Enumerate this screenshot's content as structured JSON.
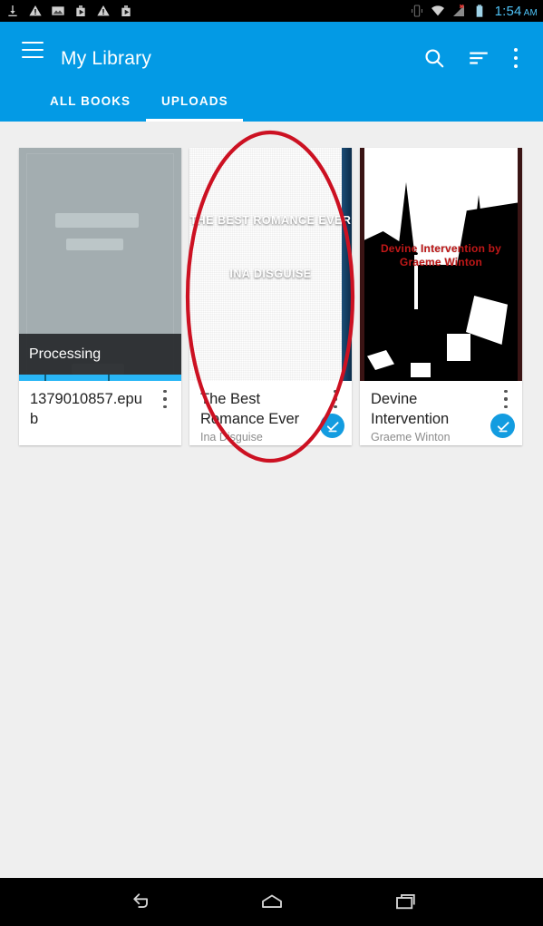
{
  "statusbar": {
    "left_icons": [
      "download-icon",
      "warning-icon",
      "image-icon",
      "play-store-icon",
      "warning-icon",
      "play-store-icon"
    ],
    "right_icons": [
      "vibrate-icon",
      "wifi-icon",
      "cell-signal-no-service-icon",
      "battery-icon"
    ],
    "time": "1:54",
    "ampm": "AM",
    "time_color": "#4fc3f7"
  },
  "appbar": {
    "title": "My Library",
    "menu_icon": "hamburger-menu-icon",
    "search_icon": "search-icon",
    "sort_icon": "sort-icon",
    "overflow_icon": "overflow-menu-icon",
    "background": "#039ae5"
  },
  "tabs": [
    {
      "label": "ALL BOOKS",
      "selected": false
    },
    {
      "label": "UPLOADS",
      "selected": true
    }
  ],
  "books": [
    {
      "title": "1379010857.epub",
      "author": "",
      "cover_type": "placeholder",
      "status_overlay": "Processing",
      "progress_visible": true,
      "badge": null,
      "overflow_icon": "overflow-menu-icon"
    },
    {
      "title": "The Best Romance Ever",
      "author": "Ina Disguise",
      "cover_type": "blue-book",
      "cover_title": "THE BEST ROMANCE EVER",
      "cover_author": "INA DISGUISE",
      "status_overlay": null,
      "progress_visible": false,
      "badge": "downloaded-check-icon",
      "overflow_icon": "overflow-menu-icon"
    },
    {
      "title": "Devine Intervention",
      "author": "Graeme Winton",
      "cover_type": "photo-bw",
      "cover_text": "Devine Intervention by Graeme Winton",
      "status_overlay": null,
      "progress_visible": false,
      "badge": "downloaded-check-icon",
      "overflow_icon": "overflow-menu-icon"
    }
  ],
  "annotation": {
    "shape": "ellipse",
    "color": "#cc1122",
    "target": "The Best Romance Ever"
  },
  "navbar": {
    "back_icon": "back-arrow-icon",
    "home_icon": "home-icon",
    "recents_icon": "recent-apps-icon"
  },
  "colors": {
    "accent": "#039ae5",
    "badge": "#139ce0",
    "page_background": "#efefef",
    "progress": "#29b6f6"
  }
}
